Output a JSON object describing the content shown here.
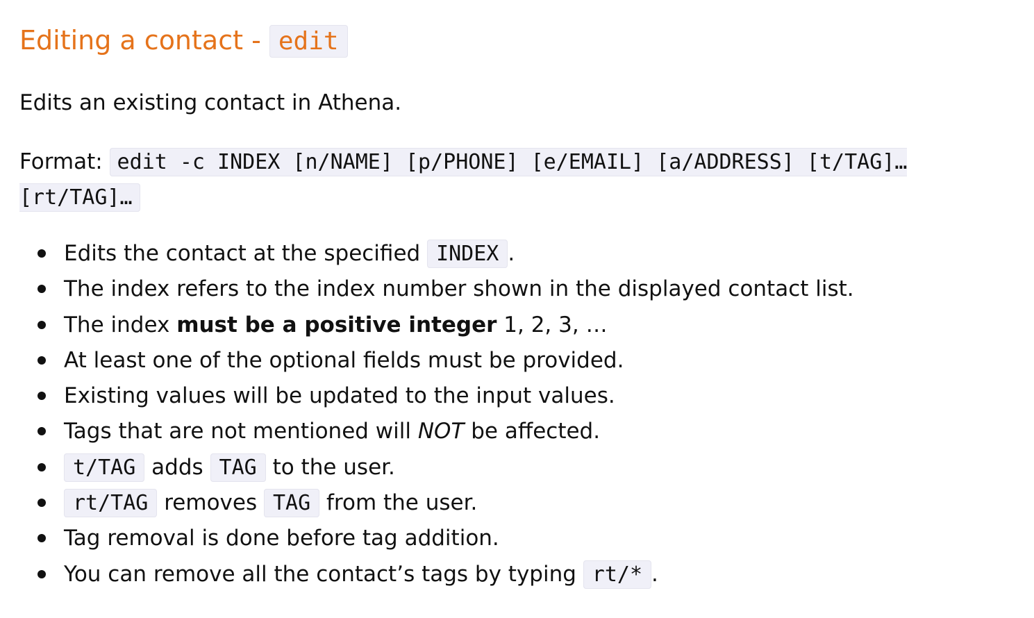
{
  "heading": {
    "text": "Editing a contact - ",
    "command": "edit"
  },
  "intro": "Edits an existing contact in Athena.",
  "format": {
    "label": "Format:",
    "code": "edit -c INDEX [n/NAME] [p/PHONE] [e/EMAIL] [a/ADDRESS] [t/TAG]… [rt/TAG]…"
  },
  "bullets": {
    "b1": {
      "pre": "Edits the contact at the specified ",
      "code": "INDEX",
      "post": "."
    },
    "b2": {
      "text": "The index refers to the index number shown in the displayed contact list."
    },
    "b3": {
      "pre": "The index ",
      "bold": "must be a positive integer",
      "post": " 1, 2, 3, …"
    },
    "b4": {
      "text": "At least one of the optional fields must be provided."
    },
    "b5": {
      "text": "Existing values will be updated to the input values."
    },
    "b6": {
      "pre": "Tags that are not mentioned will ",
      "italic": "NOT",
      "post": " be affected."
    },
    "b7": {
      "code1": "t/TAG",
      "mid": " adds ",
      "code2": "TAG",
      "post": " to the user."
    },
    "b8": {
      "code1": "rt/TAG",
      "mid": " removes ",
      "code2": "TAG",
      "post": " from the user."
    },
    "b9": {
      "text": "Tag removal is done before tag addition."
    },
    "b10": {
      "pre": "You can remove all the contact’s tags by typing ",
      "code": "rt/*",
      "post": "."
    }
  },
  "colors": {
    "heading": "#e5731b",
    "code_background": "#f0f0f8",
    "text": "#111111"
  }
}
